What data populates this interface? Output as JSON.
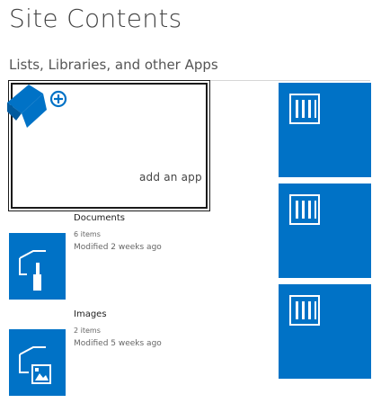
{
  "page": {
    "title": "Site Contents",
    "section_header": "Lists, Libraries, and other Apps"
  },
  "add_app": {
    "label": "add an app",
    "icon": "add-app-icon"
  },
  "apps": [
    {
      "title": "Documents",
      "count": "6 items",
      "modified": "Modified 2 weeks ago",
      "icon": "document-library-icon"
    },
    {
      "title": "Images",
      "count": "2 items",
      "modified": "Modified 5 weeks ago",
      "icon": "picture-library-icon"
    }
  ],
  "side_tiles": [
    {
      "icon": "list-app-icon"
    },
    {
      "icon": "list-app-icon"
    },
    {
      "icon": "list-app-icon"
    }
  ],
  "colors": {
    "tile_blue": "#0072c6",
    "text": "#444444"
  }
}
